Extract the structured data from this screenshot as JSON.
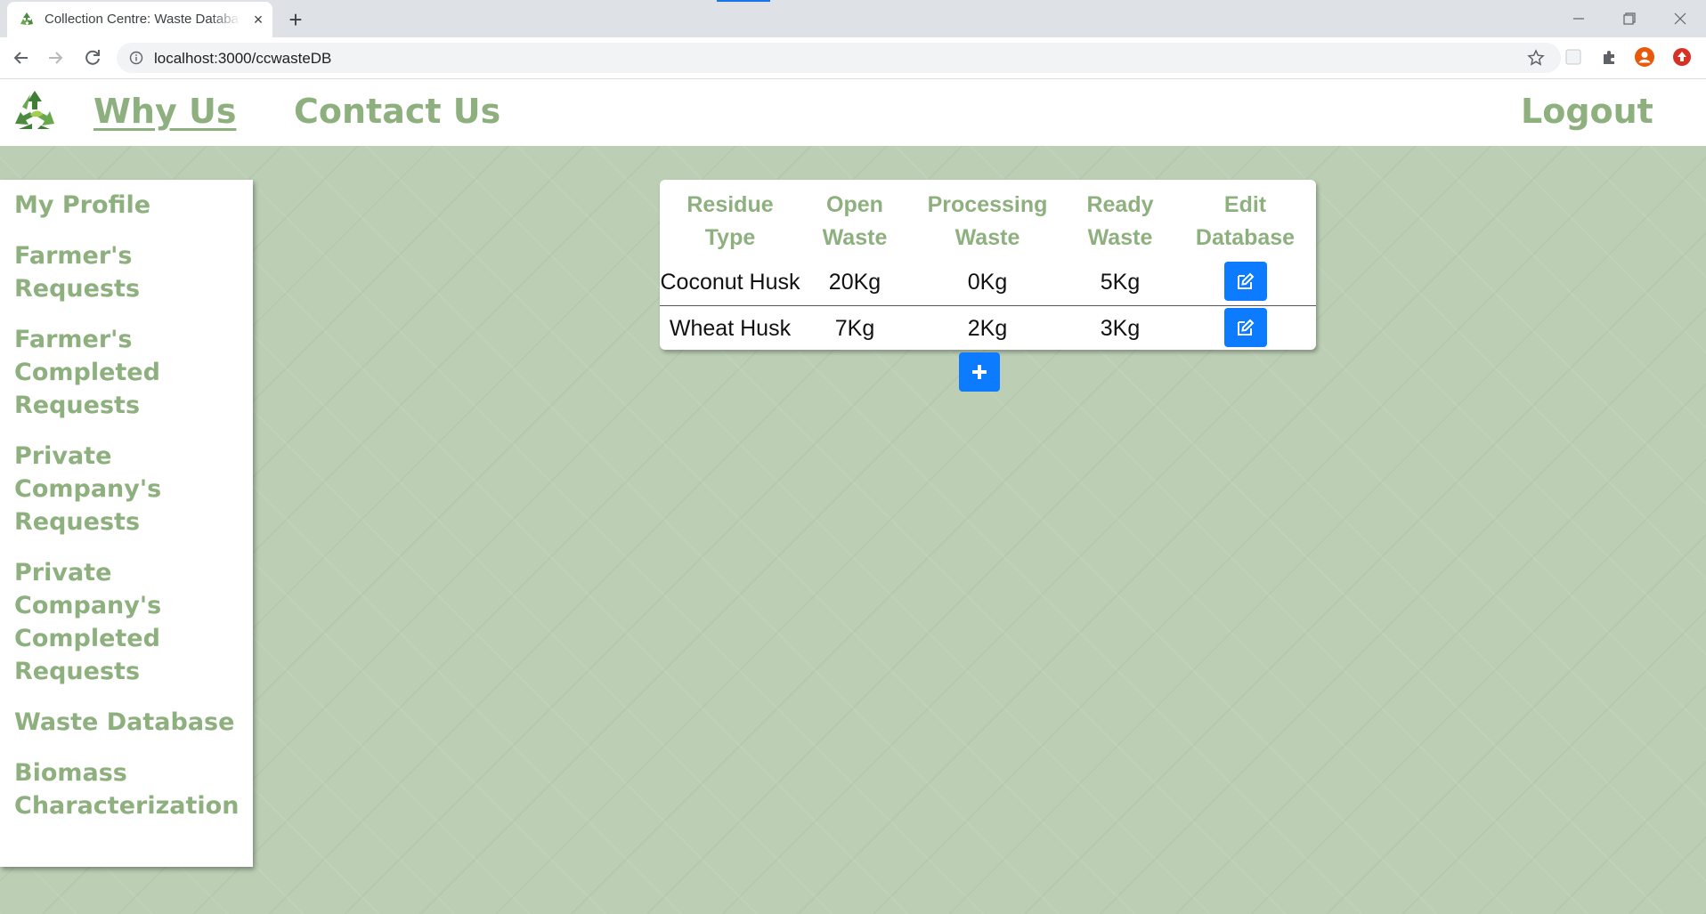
{
  "browser": {
    "tab_title": "Collection Centre: Waste Database",
    "tab_close": "×",
    "new_tab": "+",
    "url": "localhost:3000/ccwasteDB"
  },
  "navbar": {
    "why_us": "Why Us",
    "contact_us": "Contact Us",
    "logout": "Logout",
    "logo_icon": "recycle-icon"
  },
  "sidebar": {
    "items": [
      {
        "label": "My Profile"
      },
      {
        "label": "Farmer's Requests"
      },
      {
        "label": "Farmer's Completed Requests"
      },
      {
        "label": "Private Company's Requests"
      },
      {
        "label": "Private Company's Completed Requests"
      },
      {
        "label": "Waste Database"
      },
      {
        "label": "Biomass Characterization"
      }
    ]
  },
  "table": {
    "headers": [
      "Residue Type",
      "Open Waste",
      "Processing Waste",
      "Ready Waste",
      "Edit Database"
    ],
    "rows": [
      [
        "Coconut Husk",
        "20Kg",
        "0Kg",
        "5Kg"
      ],
      [
        "Wheat Husk",
        "7Kg",
        "2Kg",
        "3Kg"
      ]
    ]
  },
  "colors": {
    "accent_green": "#8db07e",
    "background": "#bccfb5",
    "button_blue": "#0d7bff"
  }
}
